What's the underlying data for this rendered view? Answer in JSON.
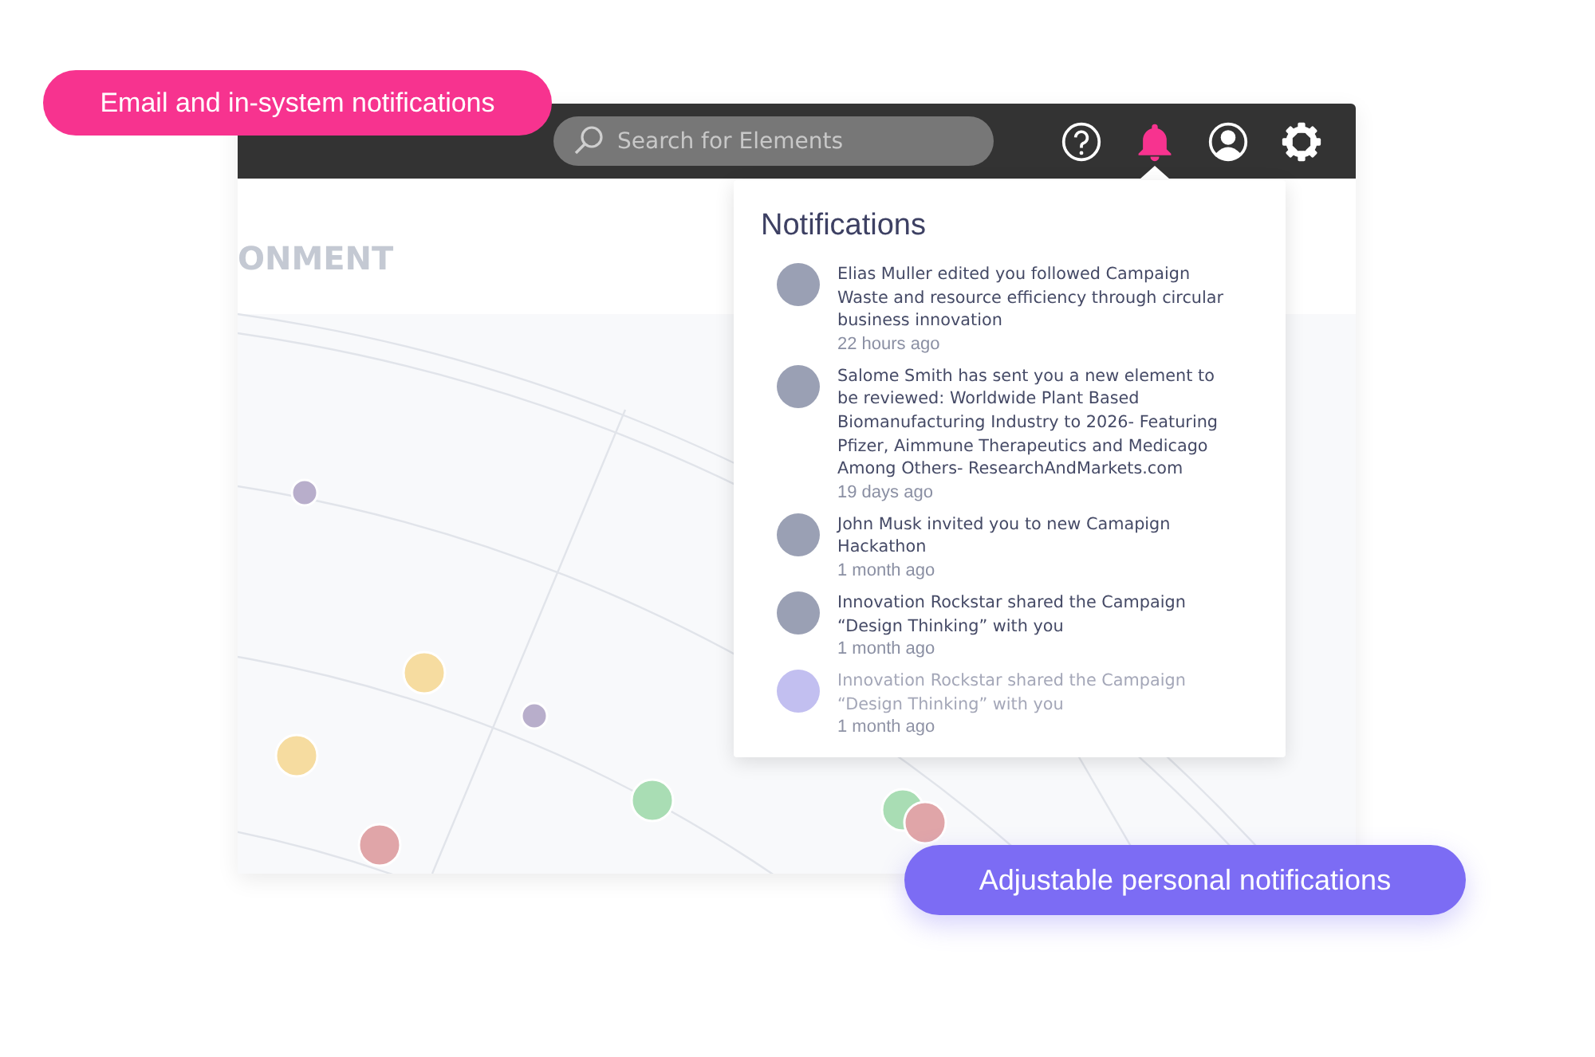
{
  "callouts": [
    {
      "text": "Email and in-system notifications",
      "color": "#f7338f"
    },
    {
      "text": "Adjustable personal notifications",
      "color": "#7c6cf4"
    }
  ],
  "top_bar": {
    "search": {
      "placeholder": "Search for Elements"
    },
    "icons": [
      {
        "kind": "help",
        "active": false
      },
      {
        "kind": "bell",
        "active": true
      },
      {
        "kind": "user",
        "active": false
      },
      {
        "kind": "settings",
        "active": false
      }
    ]
  },
  "section_heading": "ONMENT",
  "notifications": {
    "title": "Notifications",
    "items": [
      {
        "text": "Elias Muller edited you followed Campaign Waste and resource efficiency through circular business innovation",
        "time": "22 hours ago",
        "faded": false
      },
      {
        "text": "Salome Smith has sent you a new element to be reviewed: Worldwide Plant Based Biomanufacturing Industry to 2026- Featuring Pfizer, Aimmune Therapeutics and Medicago Among Others- ResearchAndMarkets.com",
        "time": "19 days ago",
        "faded": false
      },
      {
        "text": "John Musk invited you to new Camapign Hackathon",
        "time": "1 month ago",
        "faded": false
      },
      {
        "text": "Innovation Rockstar shared the Campaign “Design Thinking” with you",
        "time": "1 month ago",
        "faded": false
      },
      {
        "text": "Innovation Rockstar shared the Campaign “Design Thinking” with you",
        "time": "1 month ago",
        "faded": true
      }
    ]
  }
}
